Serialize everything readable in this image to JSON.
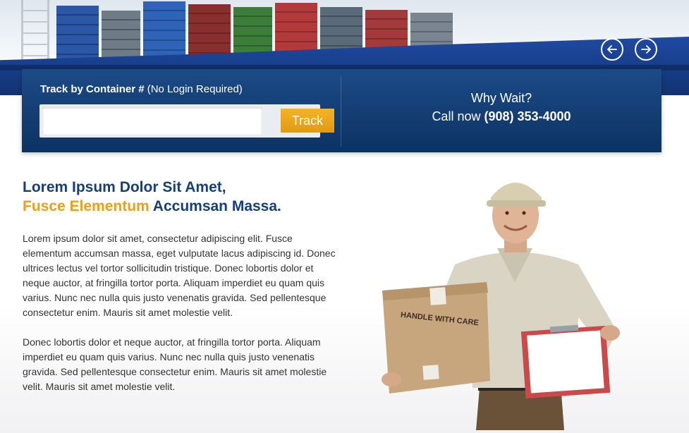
{
  "hero": {
    "prev_icon": "arrow-left-circle-icon",
    "next_icon": "arrow-right-circle-icon",
    "arrow_color": "#ffffff"
  },
  "track": {
    "label_bold": "Track by Container #",
    "label_rest": " (No Login Required)",
    "input_value": "",
    "input_placeholder": "",
    "button_label": "Track",
    "button_color": "#e9a01b"
  },
  "contact": {
    "line1": "Why Wait?",
    "line2_prefix": "Call now ",
    "phone": "(908) 353-4000"
  },
  "content": {
    "headline_line1": "Lorem Ipsum Dolor Sit Amet,",
    "headline_accent": "Fusce Elementum",
    "headline_rest": " Accumsan Massa.",
    "paragraph1": "Lorem ipsum dolor sit amet, consectetur adipiscing elit. Fusce elementum accumsan massa, eget vulputate lacus adipiscing id. Donec ultrices lectus vel tortor sollicitudin tristique. Donec lobortis dolor et neque auctor, at fringilla tortor porta. Aliquam imperdiet eu quam quis varius. Nunc nec nulla quis justo venenatis gravida. Sed pellentesque consectetur enim. Mauris sit amet molestie velit.",
    "paragraph2": "Donec lobortis dolor et neque auctor, at fringilla tortor porta. Aliquam imperdiet eu quam quis varius. Nunc nec nulla quis justo venenatis gravida. Sed pellentesque consectetur enim. Mauris sit amet molestie velit. Mauris sit amet molestie velit."
  },
  "courier": {
    "box_text": "HANDLE WITH CARE"
  },
  "colors": {
    "brand_navy": "#153f77",
    "panel_blue": "#0c3264",
    "accent_orange": "#e9a01b"
  }
}
